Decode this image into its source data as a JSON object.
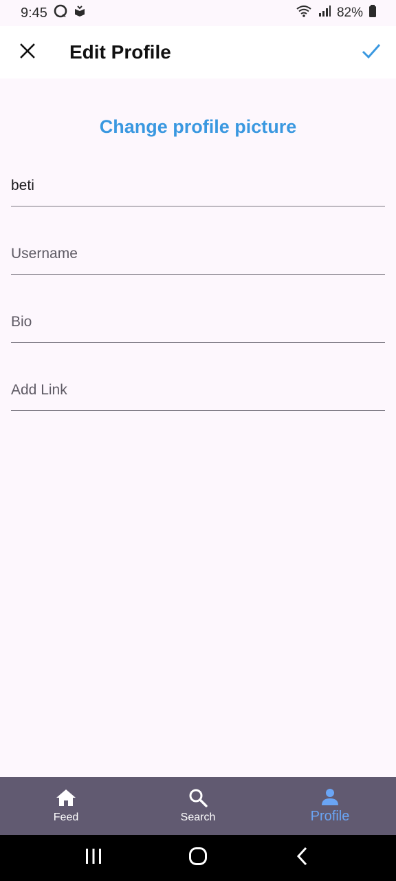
{
  "status_bar": {
    "time": "9:45",
    "battery": "82%"
  },
  "app_bar": {
    "title": "Edit Profile",
    "close_icon": "close-icon",
    "confirm_icon": "check-icon"
  },
  "content": {
    "change_picture_label": "Change profile picture",
    "fields": {
      "name": {
        "value": "beti",
        "placeholder": ""
      },
      "username": {
        "value": "",
        "placeholder": "Username"
      },
      "bio": {
        "value": "",
        "placeholder": "Bio"
      },
      "link": {
        "value": "",
        "placeholder": "Add Link"
      }
    }
  },
  "bottom_nav": {
    "items": [
      {
        "label": "Feed",
        "icon": "home-icon",
        "active": false
      },
      {
        "label": "Search",
        "icon": "search-icon",
        "active": false
      },
      {
        "label": "Profile",
        "icon": "person-icon",
        "active": true
      }
    ]
  },
  "colors": {
    "accent": "#3a98e0",
    "nav_background": "#615a71",
    "nav_active": "#6aa5f5",
    "background": "#fdf7fd"
  }
}
